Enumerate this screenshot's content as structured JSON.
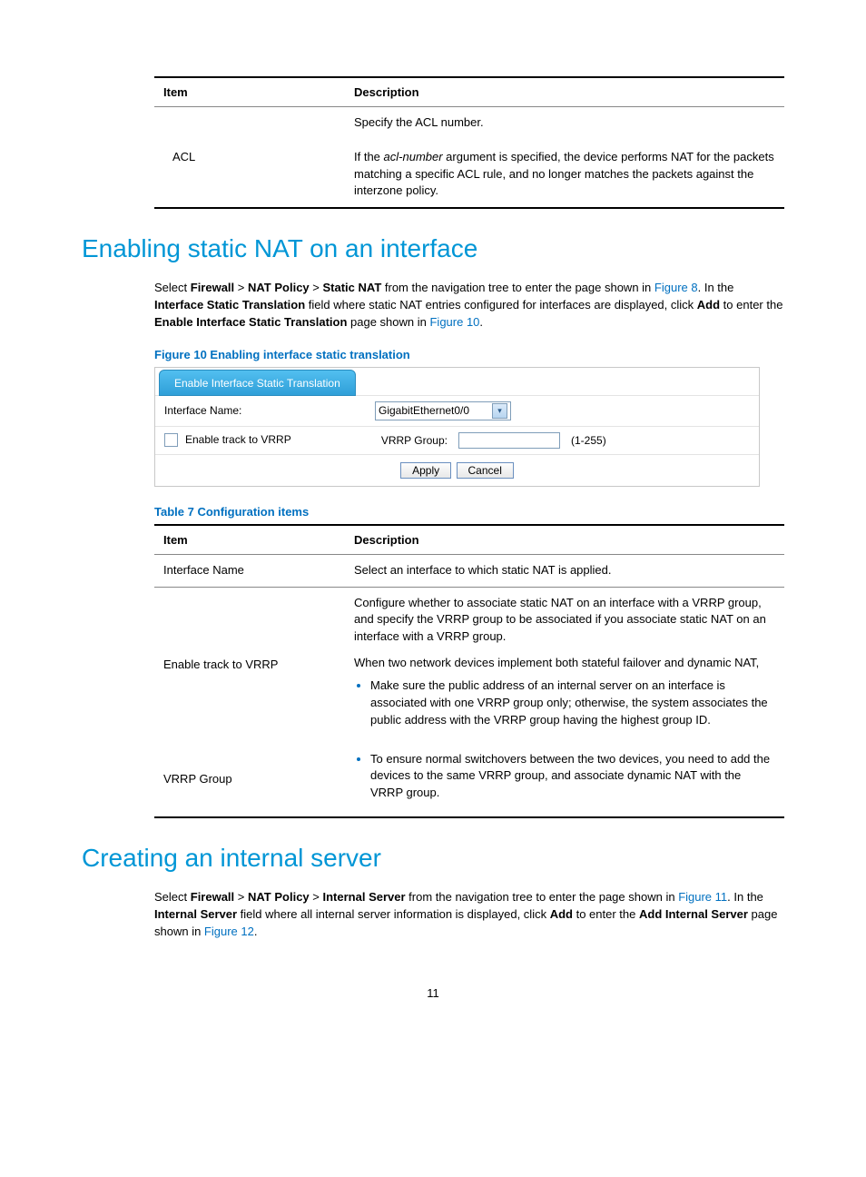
{
  "top_table": {
    "headers": [
      "Item",
      "Description"
    ],
    "item": "ACL",
    "desc_line1": "Specify the ACL number.",
    "desc_line2_a": "If the ",
    "desc_line2_italic": "acl-number",
    "desc_line2_b": " argument is specified, the device performs NAT for the packets matching a specific ACL rule, and no longer matches the packets against the interzone policy."
  },
  "section1": {
    "heading": "Enabling static NAT on an interface",
    "para_a": "Select ",
    "para_b_bold": "Firewall",
    "para_gt": " > ",
    "para_c_bold": "NAT Policy",
    "para_d_bold": "Static NAT",
    "para_e": " from the navigation tree to enter the page shown in ",
    "para_link1": "Figure 8",
    "para_f": ". In the ",
    "para_g_bold": "Interface Static Translation",
    "para_h": " field where static NAT entries configured for interfaces are displayed, click ",
    "para_i_bold": "Add",
    "para_j": " to enter the ",
    "para_k_bold": "Enable Interface Static Translation",
    "para_l": " page shown in ",
    "para_link2": "Figure 10",
    "para_m": "."
  },
  "figure10": {
    "caption": "Figure 10 Enabling interface static translation",
    "tab": "Enable Interface Static Translation",
    "row1_label": "Interface Name:",
    "row1_select": "GigabitEthernet0/0",
    "row2_checkbox_label": "Enable track to VRRP",
    "row2_label": "VRRP Group:",
    "row2_hint": "(1-255)",
    "btn_apply": "Apply",
    "btn_cancel": "Cancel"
  },
  "table7": {
    "caption": "Table 7 Configuration items",
    "headers": [
      "Item",
      "Description"
    ],
    "r1_item": "Interface Name",
    "r1_desc": "Select an interface to which static NAT is applied.",
    "r2_item": "Enable track to VRRP",
    "r2_desc_p1": "Configure whether to associate static NAT on an interface with a VRRP group, and specify the VRRP group to be associated if you associate static NAT on an interface with a VRRP group.",
    "r2_desc_p2": "When two network devices implement both stateful failover and dynamic NAT,",
    "r3_item": "VRRP Group",
    "bullet1": "Make sure the public address of an internal server on an interface is associated with one VRRP group only; otherwise, the system associates the public address with the VRRP group having the highest group ID.",
    "bullet2": "To ensure normal switchovers between the two devices, you need to add the devices to the same VRRP group, and associate dynamic NAT with the VRRP group."
  },
  "section2": {
    "heading": "Creating an internal server",
    "para_a": "Select ",
    "para_b_bold": "Firewall",
    "para_gt": " > ",
    "para_c_bold": "NAT Policy",
    "para_d_bold": "Internal Server",
    "para_e": " from the navigation tree to enter the page shown in ",
    "para_link1": "Figure 11",
    "para_f": ". In the ",
    "para_g_bold": "Internal Server",
    "para_h": " field where all internal server information is displayed, click ",
    "para_i_bold": "Add",
    "para_j": " to enter the ",
    "para_k_bold": "Add Internal Server",
    "para_l": " page shown in ",
    "para_link2": "Figure 12",
    "para_m": "."
  },
  "page_number": "11"
}
